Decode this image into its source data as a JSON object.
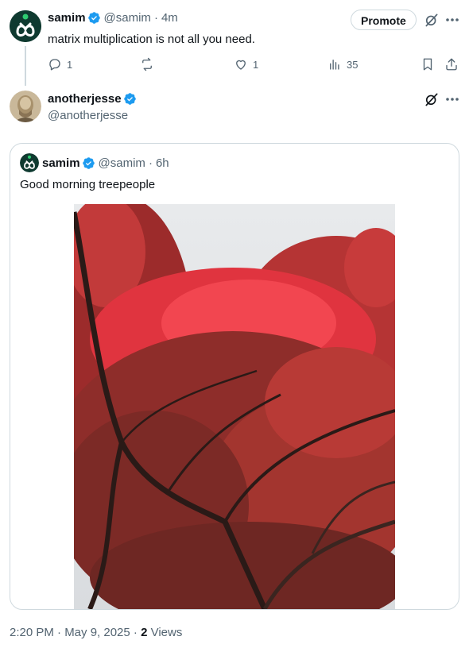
{
  "first_tweet": {
    "display_name": "samim",
    "handle": "@samim",
    "time": "4m",
    "text": "matrix multiplication is not all you need.",
    "promote_label": "Promote",
    "actions": {
      "replies": "1",
      "reposts": "",
      "likes": "1",
      "views": "35"
    }
  },
  "main_tweet": {
    "display_name": "anotherjesse",
    "handle": "@anotherjesse",
    "quoted": {
      "display_name": "samim",
      "handle": "@samim",
      "time": "6h",
      "text": "Good morning treepeople"
    },
    "footer": {
      "timestamp": "2:20 PM · May 9, 2025 · ",
      "views_count": "2",
      "views_label": " Views"
    }
  },
  "colors": {
    "verified_blue": "#1d9bf0",
    "muted_text": "#536471",
    "border": "#cfd9de"
  },
  "icons": [
    "reply-icon",
    "repost-icon",
    "like-icon",
    "views-icon",
    "bookmark-icon",
    "share-icon",
    "grok-icon",
    "more-icon",
    "verified-icon"
  ]
}
